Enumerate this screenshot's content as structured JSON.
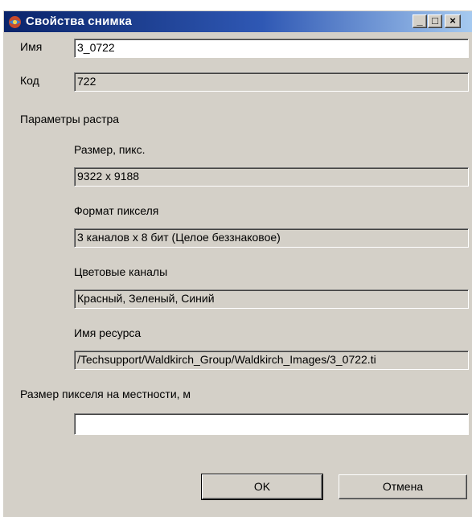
{
  "window": {
    "title": "Свойства снимка",
    "controls": {
      "minimize": "_",
      "maximize": "□",
      "close": "×"
    }
  },
  "name": {
    "label": "Имя",
    "value": "3_0722"
  },
  "code": {
    "label": "Код",
    "value": "722"
  },
  "raster": {
    "section_label": "Параметры растра",
    "size": {
      "label": "Размер, пикс.",
      "value": "9322 x 9188"
    },
    "pixel_format": {
      "label": "Формат пикселя",
      "value": "3 каналов x 8 бит (Целое беззнаковое)"
    },
    "color_channels": {
      "label": "Цветовые каналы",
      "value": "Красный, Зеленый, Синий"
    },
    "resource_name": {
      "label": "Имя ресурса",
      "value": "/Techsupport/Waldkirch_Group/Waldkirch_Images/3_0722.ti"
    }
  },
  "ground_pixel": {
    "label": "Размер пикселя на местности, м",
    "value": ""
  },
  "buttons": {
    "ok": "OK",
    "cancel": "Отмена"
  },
  "icons": {
    "title": "app-globe-icon"
  },
  "colors": {
    "title_start": "#0a246a",
    "title_end": "#a6caf0",
    "dialog_bg": "#d4d0c8"
  }
}
